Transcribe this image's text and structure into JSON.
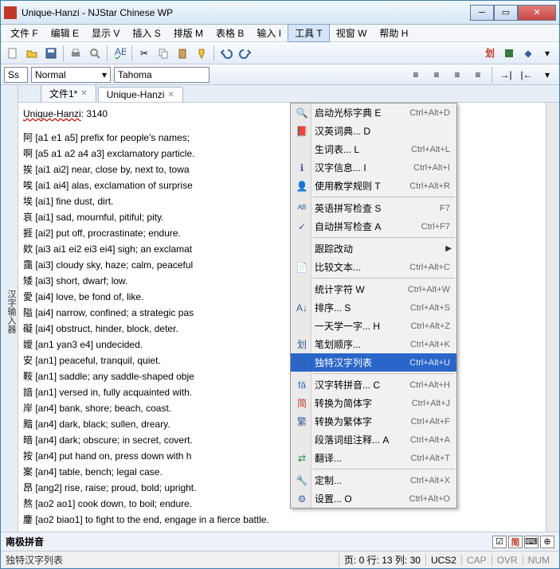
{
  "window_title": "Unique-Hanzi - NJStar Chinese WP",
  "menubar": [
    "文件 F",
    "编辑 E",
    "显示 V",
    "插入 S",
    "排版 M",
    "表格 B",
    "输入 I",
    "工具 T",
    "视窗 W",
    "帮助 H"
  ],
  "active_menu_index": 7,
  "style_combo": "Ss",
  "name_combo": "Normal",
  "font_combo": "Tahoma",
  "left_rail": "汉字输入器",
  "tabs": [
    {
      "label": "文件1*",
      "active": false
    },
    {
      "label": "Unique-Hanzi",
      "active": true
    }
  ],
  "doc_heading": "Unique-Hanzi: 3140",
  "doc_lines": [
    "阿 [a1 e1 a5] prefix for people's names;",
    "啊 [a5 a1 a2 a4 a3] exclamatory particle.",
    "挨 [ai1 ai2] near, close by, next to, towa",
    "唉 [ai1 ai4] alas, exclamation of surprise",
    "埃 [ai1] fine dust, dirt.",
    "哀 [ai1] sad, mournful, pitiful; pity.",
    "捱 [ai2] put off, procrastinate; endure.",
    "欸 [ai3 ai1 ei2 ei3 ei4] sigh; an exclamat",
    "靄 [ai3] cloudy sky, haze; calm, peaceful",
    "矮 [ai3] short, dwarf; low.",
    "愛 [ai4] love, be fond of, like.",
    "隘 [ai4] narrow, confined; a strategic pas",
    "礙 [ai4] obstruct, hinder, block, deter.",
    "嬡 [an1 yan3 e4] undecided.",
    "安 [an1] peaceful, tranquil, quiet.",
    "鞍 [an1] saddle; any saddle-shaped obje",
    "諳 [an1] versed in, fully acquainted with.",
    "岸 [an4] bank, shore; beach, coast.",
    "黯 [an4] dark, black; sullen, dreary.",
    "暗 [an4] dark; obscure; in secret, covert.",
    "按 [an4] put hand on, press down with h",
    "案 [an4] table, bench; legal case.",
    "昂 [ang2] rise, raise; proud, bold; upright.",
    "熬 [ao2 ao1] cook down, to boil; endure.",
    "鏖 [ao2 biao1] to fight to the end, engage in a fierce battle."
  ],
  "tools_menu": [
    {
      "icon": "🔍",
      "label": "启动光标字典 E",
      "sc": "Ctrl+Alt+D"
    },
    {
      "icon": "📕",
      "label": "汉英词典... D",
      "sc": ""
    },
    {
      "icon": "",
      "label": "生词表... L",
      "sc": "Ctrl+Alt+L"
    },
    {
      "icon": "ℹ",
      "label": "汉字信息... I",
      "sc": "Ctrl+Alt+I"
    },
    {
      "icon": "👤",
      "label": "使用教学规则 T",
      "sc": "Ctrl+Alt+R"
    },
    {
      "sep": true
    },
    {
      "icon": "ᴬᴮ",
      "label": "英语拼写检查 S",
      "sc": "F7"
    },
    {
      "icon": "✓",
      "label": "自动拼写检查 A",
      "sc": "Ctrl+F7"
    },
    {
      "sep": true
    },
    {
      "icon": "",
      "label": "跟踪改动",
      "sc": "",
      "arrow": true
    },
    {
      "icon": "📄",
      "label": "比较文本...",
      "sc": "Ctrl+Alt+C"
    },
    {
      "sep": true
    },
    {
      "icon": "",
      "label": "统计字符 W",
      "sc": "Ctrl+Alt+W"
    },
    {
      "icon": "A↓",
      "label": "排序... S",
      "sc": "Ctrl+Alt+S"
    },
    {
      "icon": "",
      "label": "一天学一字... H",
      "sc": "Ctrl+Alt+Z"
    },
    {
      "icon": "划",
      "label": "笔划顺序...",
      "sc": "Ctrl+Alt+K"
    },
    {
      "icon": "列",
      "label": "独特汉字列表",
      "sc": "Ctrl+Alt+U",
      "selected": true
    },
    {
      "sep": true
    },
    {
      "icon": "fǎ",
      "label": "汉字转拼音... C",
      "sc": "Ctrl+Alt+H",
      "iconcolor": "#2a66c9"
    },
    {
      "icon": "简",
      "label": "转换为简体字",
      "sc": "Ctrl+Alt+J",
      "iconcolor": "#c0392b"
    },
    {
      "icon": "繁",
      "label": "转换为繁体字",
      "sc": "Ctrl+Alt+F"
    },
    {
      "icon": "",
      "label": "段落词组注释... A",
      "sc": "Ctrl+Alt+A"
    },
    {
      "icon": "⇄",
      "label": "翻译...",
      "sc": "Ctrl+Alt+T",
      "iconcolor": "#1a8a3a"
    },
    {
      "sep": true
    },
    {
      "icon": "🔧",
      "label": "定制...",
      "sc": "Ctrl+Alt+X",
      "iconcolor": "#2a66c9"
    },
    {
      "icon": "⚙",
      "label": "设置... O",
      "sc": "Ctrl+Alt+O"
    }
  ],
  "bottom_label": "南极拼音",
  "bottom_buttons": [
    "☑",
    "简",
    "⌨",
    "⊕"
  ],
  "status_left": "独特汉字列表",
  "status_pos": "页: 0  行: 13  列: 30",
  "status_enc": "UCS2",
  "status_flags": [
    "CAP",
    "OVR",
    "NUM"
  ]
}
